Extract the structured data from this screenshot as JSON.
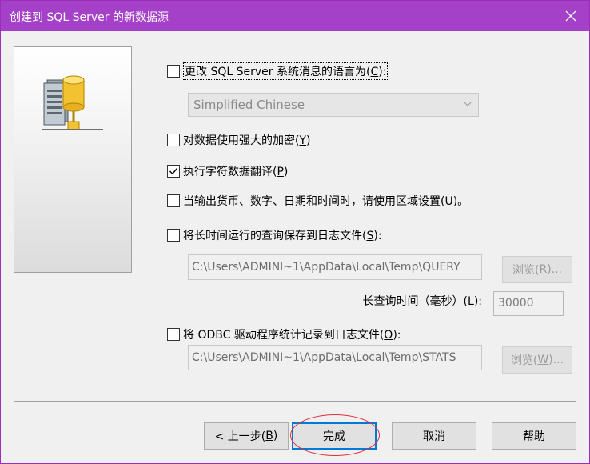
{
  "window": {
    "title": "创建到 SQL Server 的新数据源"
  },
  "options": {
    "change_language": {
      "label": "更改 SQL Server 系统消息的语言为(",
      "key": "C",
      "suffix": "):",
      "checked": false
    },
    "language_select": {
      "value": "Simplified Chinese"
    },
    "strong_encryption": {
      "label": "对数据使用强大的加密(",
      "key": "Y",
      "suffix": ")",
      "checked": false
    },
    "char_translation": {
      "label": "执行字符数据翻译(",
      "key": "P",
      "suffix": ")",
      "checked": true
    },
    "regional_settings": {
      "label": "当输出货币、数字、日期和时间时，请使用区域设置(",
      "key": "U",
      "suffix": ")。",
      "checked": false
    },
    "save_long_queries": {
      "label": "将长时间运行的查询保存到日志文件(",
      "key": "S",
      "suffix": "):",
      "checked": false
    },
    "long_query_path": "C:\\Users\\ADMINI~1\\AppData\\Local\\Temp\\QUERY",
    "browse1": {
      "text": "浏览(",
      "key": "R",
      "suffix": ")..."
    },
    "long_query_time": {
      "label": "长查询时间（毫秒）(",
      "key": "L",
      "suffix": "):",
      "value": "30000"
    },
    "log_odbc_stats": {
      "label": "将 ODBC 驱动程序统计记录到日志文件(",
      "key": "O",
      "suffix": "):",
      "checked": false
    },
    "stats_path": "C:\\Users\\ADMINI~1\\AppData\\Local\\Temp\\STATS",
    "browse2": {
      "text": "浏览(",
      "key": "W",
      "suffix": ")..."
    }
  },
  "buttons": {
    "back": {
      "text": "< 上一步(",
      "key": "B",
      "suffix": ")"
    },
    "finish": "完成",
    "cancel": "取消",
    "help": "帮助"
  },
  "colors": {
    "titlebar": "#a540c8",
    "accent": "#0078d7",
    "annotation": "#e0303a"
  }
}
